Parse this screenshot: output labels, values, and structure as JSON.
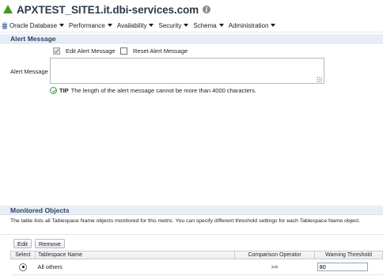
{
  "header": {
    "title": "APXTEST_SITE1.it.dbi-services.com"
  },
  "menu": [
    {
      "label": "Oracle Database",
      "icon": "database-icon"
    },
    {
      "label": "Performance"
    },
    {
      "label": "Availability"
    },
    {
      "label": "Security"
    },
    {
      "label": "Schema"
    },
    {
      "label": "Administration"
    }
  ],
  "alert_message": {
    "section_title": "Alert Message",
    "edit_label": "Edit Alert Message",
    "edit_checked": true,
    "reset_label": "Reset Alert Message",
    "reset_checked": false,
    "field_label": "Alert Message",
    "value": "",
    "tip_label": "TIP",
    "tip_text": "The length of the alert message cannot be more than 4000 characters."
  },
  "monitored": {
    "section_title": "Monitored Objects",
    "description": "The table lists all Tablespace Name objects monitored for this metric. You can specify different threshold settings for each Tablespace Name object.",
    "buttons": {
      "edit": "Edit",
      "remove": "Remove"
    },
    "columns": [
      "Select",
      "Tablespace Name",
      "Comparison Operator",
      "Warning Threshold"
    ],
    "rows": [
      {
        "selected": true,
        "name": "All others",
        "operator": ">=",
        "warning": "80"
      }
    ]
  }
}
